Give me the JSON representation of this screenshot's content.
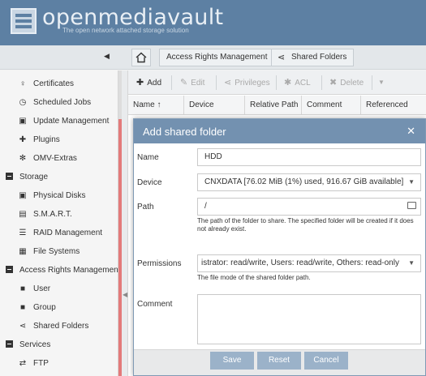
{
  "header": {
    "title": "openmediavault",
    "subtitle": "The open network attached storage solution"
  },
  "breadcrumb": {
    "items": [
      "Access Rights Management",
      "Shared Folders"
    ]
  },
  "sidebar": {
    "items": [
      {
        "type": "item",
        "label": "Certificates",
        "icon": "certificate-icon",
        "glyph": "♀"
      },
      {
        "type": "item",
        "label": "Scheduled Jobs",
        "icon": "clock-icon",
        "glyph": "◷"
      },
      {
        "type": "item",
        "label": "Update Management",
        "icon": "update-icon",
        "glyph": "▣"
      },
      {
        "type": "item",
        "label": "Plugins",
        "icon": "puzzle-icon",
        "glyph": "✚"
      },
      {
        "type": "item",
        "label": "OMV-Extras",
        "icon": "wand-icon",
        "glyph": "✻"
      },
      {
        "type": "category",
        "label": "Storage"
      },
      {
        "type": "item",
        "label": "Physical Disks",
        "icon": "disk-icon",
        "glyph": "▣"
      },
      {
        "type": "item",
        "label": "S.M.A.R.T.",
        "icon": "smart-icon",
        "glyph": "▤"
      },
      {
        "type": "item",
        "label": "RAID Management",
        "icon": "raid-icon",
        "glyph": "☰"
      },
      {
        "type": "item",
        "label": "File Systems",
        "icon": "filesystem-icon",
        "glyph": "▦"
      },
      {
        "type": "category",
        "label": "Access Rights Management"
      },
      {
        "type": "item",
        "label": "User",
        "icon": "user-icon",
        "glyph": "👤"
      },
      {
        "type": "item",
        "label": "Group",
        "icon": "group-icon",
        "glyph": "👥"
      },
      {
        "type": "item",
        "label": "Shared Folders",
        "icon": "share-icon",
        "glyph": "⋖"
      },
      {
        "type": "category",
        "label": "Services"
      },
      {
        "type": "item",
        "label": "FTP",
        "icon": "ftp-icon",
        "glyph": "⇄"
      }
    ]
  },
  "toolbar": {
    "add": "Add",
    "edit": "Edit",
    "privileges": "Privileges",
    "acl": "ACL",
    "delete": "Delete"
  },
  "grid": {
    "columns": [
      "Name ↑",
      "Device",
      "Relative Path",
      "Comment",
      "Referenced"
    ]
  },
  "dialog": {
    "title": "Add shared folder",
    "name_label": "Name",
    "name_value": "HDD",
    "device_label": "Device",
    "device_value": "CNXDATA [76.02 MiB (1%) used, 916.67 GiB available]",
    "path_label": "Path",
    "path_value": "/",
    "path_hint": "The path of the folder to share. The specified folder will be created if it does not already exist.",
    "permissions_label": "Permissions",
    "permissions_value": "istrator: read/write, Users: read/write, Others: read-only",
    "permissions_hint": "The file mode of the shared folder path.",
    "comment_label": "Comment",
    "save": "Save",
    "reset": "Reset",
    "cancel": "Cancel"
  },
  "colors": {
    "header": "#5d80a3",
    "dialog_header": "#7391b0",
    "button": "#9bb2c9"
  }
}
